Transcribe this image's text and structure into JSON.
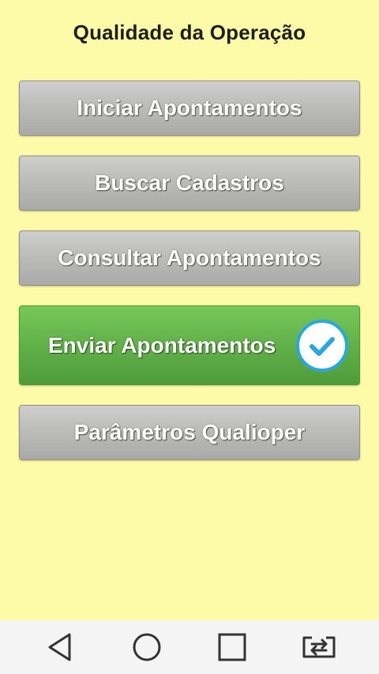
{
  "screen": {
    "title": "Qualidade da Operação"
  },
  "menu": {
    "items": [
      {
        "label": "Iniciar Apontamentos"
      },
      {
        "label": "Buscar Cadastros"
      },
      {
        "label": "Consultar Apontamentos"
      },
      {
        "label": "Enviar Apontamentos",
        "state": "selected",
        "icon": "check-circle-icon"
      },
      {
        "label": "Parâmetros Qualioper"
      }
    ]
  },
  "navbar": {
    "buttons": [
      "back-icon",
      "home-icon",
      "recents-icon",
      "rotate-screen-icon"
    ]
  },
  "colors": {
    "background": "#FEFBA8",
    "button_gray": "#C0C0BE",
    "button_green": "#63B34B",
    "check_blue": "#29A8E0",
    "navbar": "#F4F4F4"
  }
}
